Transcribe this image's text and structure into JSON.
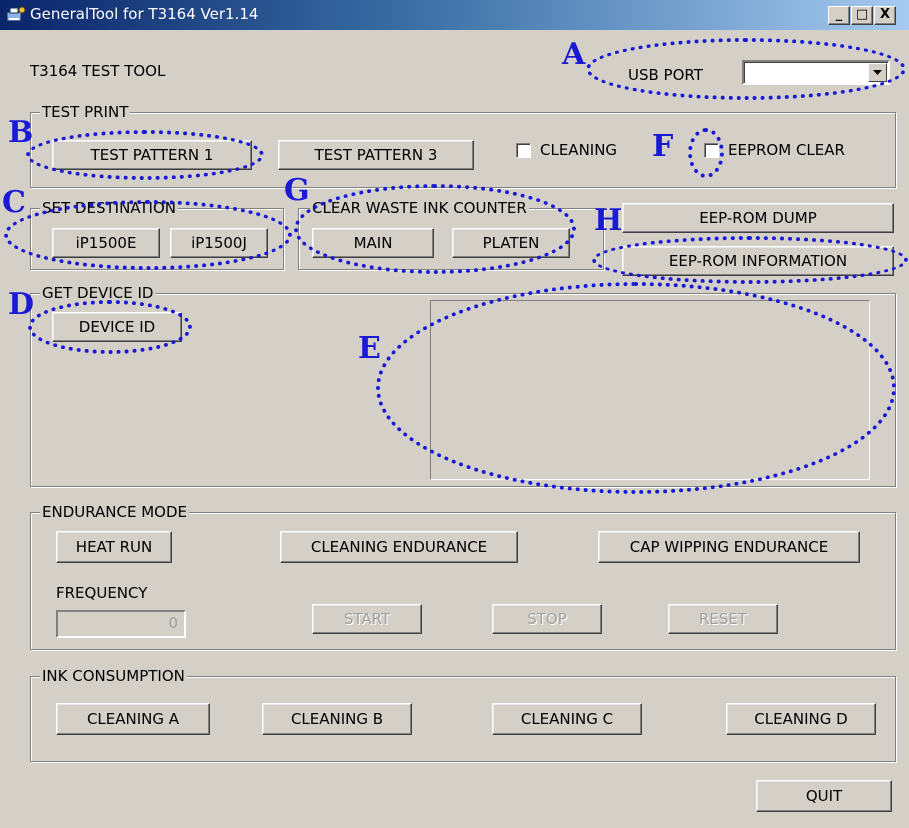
{
  "window": {
    "title": "GeneralTool for T3164 Ver1.14",
    "app_icon": "printer-tool-icon",
    "controls": {
      "minimize": "_",
      "maximize": "□",
      "close": "X"
    }
  },
  "header": {
    "tool_name": "T3164 TEST TOOL"
  },
  "usb_port": {
    "label": "USB PORT",
    "value": ""
  },
  "test_print": {
    "title": "TEST PRINT",
    "pattern1": "TEST PATTERN 1",
    "pattern3": "TEST PATTERN 3",
    "cleaning": {
      "label": "CLEANING",
      "checked": false
    },
    "eeprom_clear": {
      "label": "EEPROM CLEAR",
      "checked": false
    }
  },
  "set_destination": {
    "title": "SET DESTINATION",
    "btn1": "iP1500E",
    "btn2": "iP1500J"
  },
  "clear_waste": {
    "title": "CLEAR WASTE INK COUNTER",
    "main": "MAIN",
    "platen": "PLATEN"
  },
  "eeprom": {
    "dump": "EEP-ROM DUMP",
    "information": "EEP-ROM INFORMATION"
  },
  "device_id": {
    "title": "GET DEVICE ID",
    "button": "DEVICE ID",
    "output": ""
  },
  "endurance": {
    "title": "ENDURANCE MODE",
    "heat_run": "HEAT RUN",
    "cleaning_endurance": "CLEANING ENDURANCE",
    "cap_wipping": "CAP WIPPING ENDURANCE",
    "frequency_label": "FREQUENCY",
    "frequency_value": "0",
    "start": "START",
    "stop": "STOP",
    "reset": "RESET"
  },
  "ink_consumption": {
    "title": "INK CONSUMPTION",
    "a": "CLEANING A",
    "b": "CLEANING B",
    "c": "CLEANING C",
    "d": "CLEANING D"
  },
  "quit": "QUIT",
  "annotations": {
    "a": "A",
    "b": "B",
    "c": "C",
    "d": "D",
    "e": "E",
    "f": "F",
    "g": "G",
    "h": "H",
    "color": "#1a1ad6"
  }
}
